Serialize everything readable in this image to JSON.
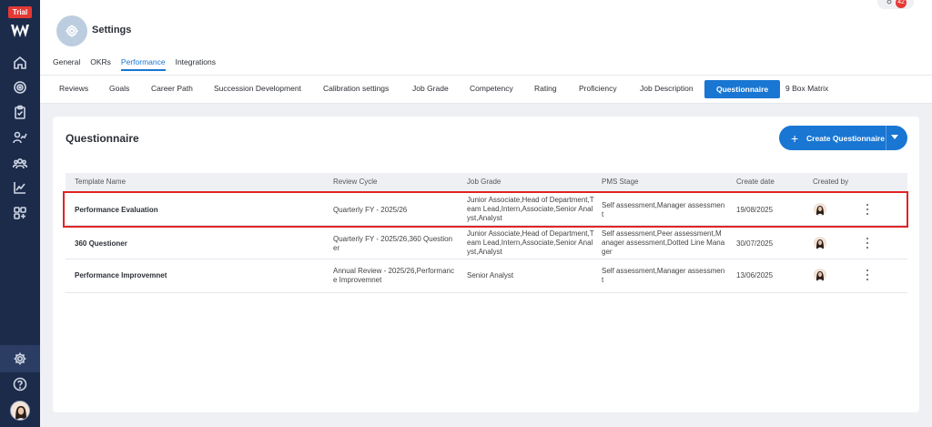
{
  "sidebar": {
    "trial_label": "Trial",
    "icons": [
      "home-icon",
      "target-icon",
      "clipboard-icon",
      "chart-user-icon",
      "team-icon",
      "trend-icon",
      "apps-icon",
      "gear-icon",
      "help-icon"
    ]
  },
  "header": {
    "notification_count": "42",
    "title": "Settings",
    "tabs": [
      {
        "label": "General"
      },
      {
        "label": "OKRs"
      },
      {
        "label": "Performance",
        "active": true
      },
      {
        "label": "Integrations"
      }
    ]
  },
  "subtabs": [
    {
      "label": "Reviews"
    },
    {
      "label": "Goals"
    },
    {
      "label": "Career Path"
    },
    {
      "label": "Succession Development"
    },
    {
      "label": "Calibration settings"
    },
    {
      "label": "Job Grade"
    },
    {
      "label": "Competency"
    },
    {
      "label": "Rating"
    },
    {
      "label": "Proficiency"
    },
    {
      "label": "Job Description"
    },
    {
      "label": "Questionnaire",
      "active": true
    },
    {
      "label": "9 Box Matrix"
    }
  ],
  "main": {
    "title": "Questionnaire",
    "create_label": "Create Questionnaire",
    "columns": [
      "Template Name",
      "Review Cycle",
      "Job Grade",
      "PMS Stage",
      "Create date",
      "Created by"
    ],
    "rows": [
      {
        "name": "Performance Evaluation",
        "review_cycle": "Quarterly FY - 2025/26",
        "job_grade": "Junior Associate,Head of Department,Team Lead,Intern,Associate,Senior Analyst,Analyst",
        "pms_stage": "Self assessment,Manager assessment",
        "create_date": "19/08/2025"
      },
      {
        "name": "360 Questioner",
        "review_cycle": "Quarterly FY - 2025/26,360 Questioner",
        "job_grade": "Junior Associate,Head of Department,Team Lead,Intern,Associate,Senior Analyst,Analyst",
        "pms_stage": "Self assessment,Peer assessment,Manager assessment,Dotted Line Manager",
        "create_date": "30/07/2025"
      },
      {
        "name": "Performance Improvemnet",
        "review_cycle": "Annual Review - 2025/26,Performance Improvemnet",
        "job_grade": "Senior Analyst",
        "pms_stage": "Self assessment,Manager assessment",
        "create_date": "13/06/2025"
      }
    ]
  },
  "colors": {
    "sidebar_bg": "#1c2b4a",
    "accent": "#1976d2",
    "highlight": "#e02424"
  }
}
